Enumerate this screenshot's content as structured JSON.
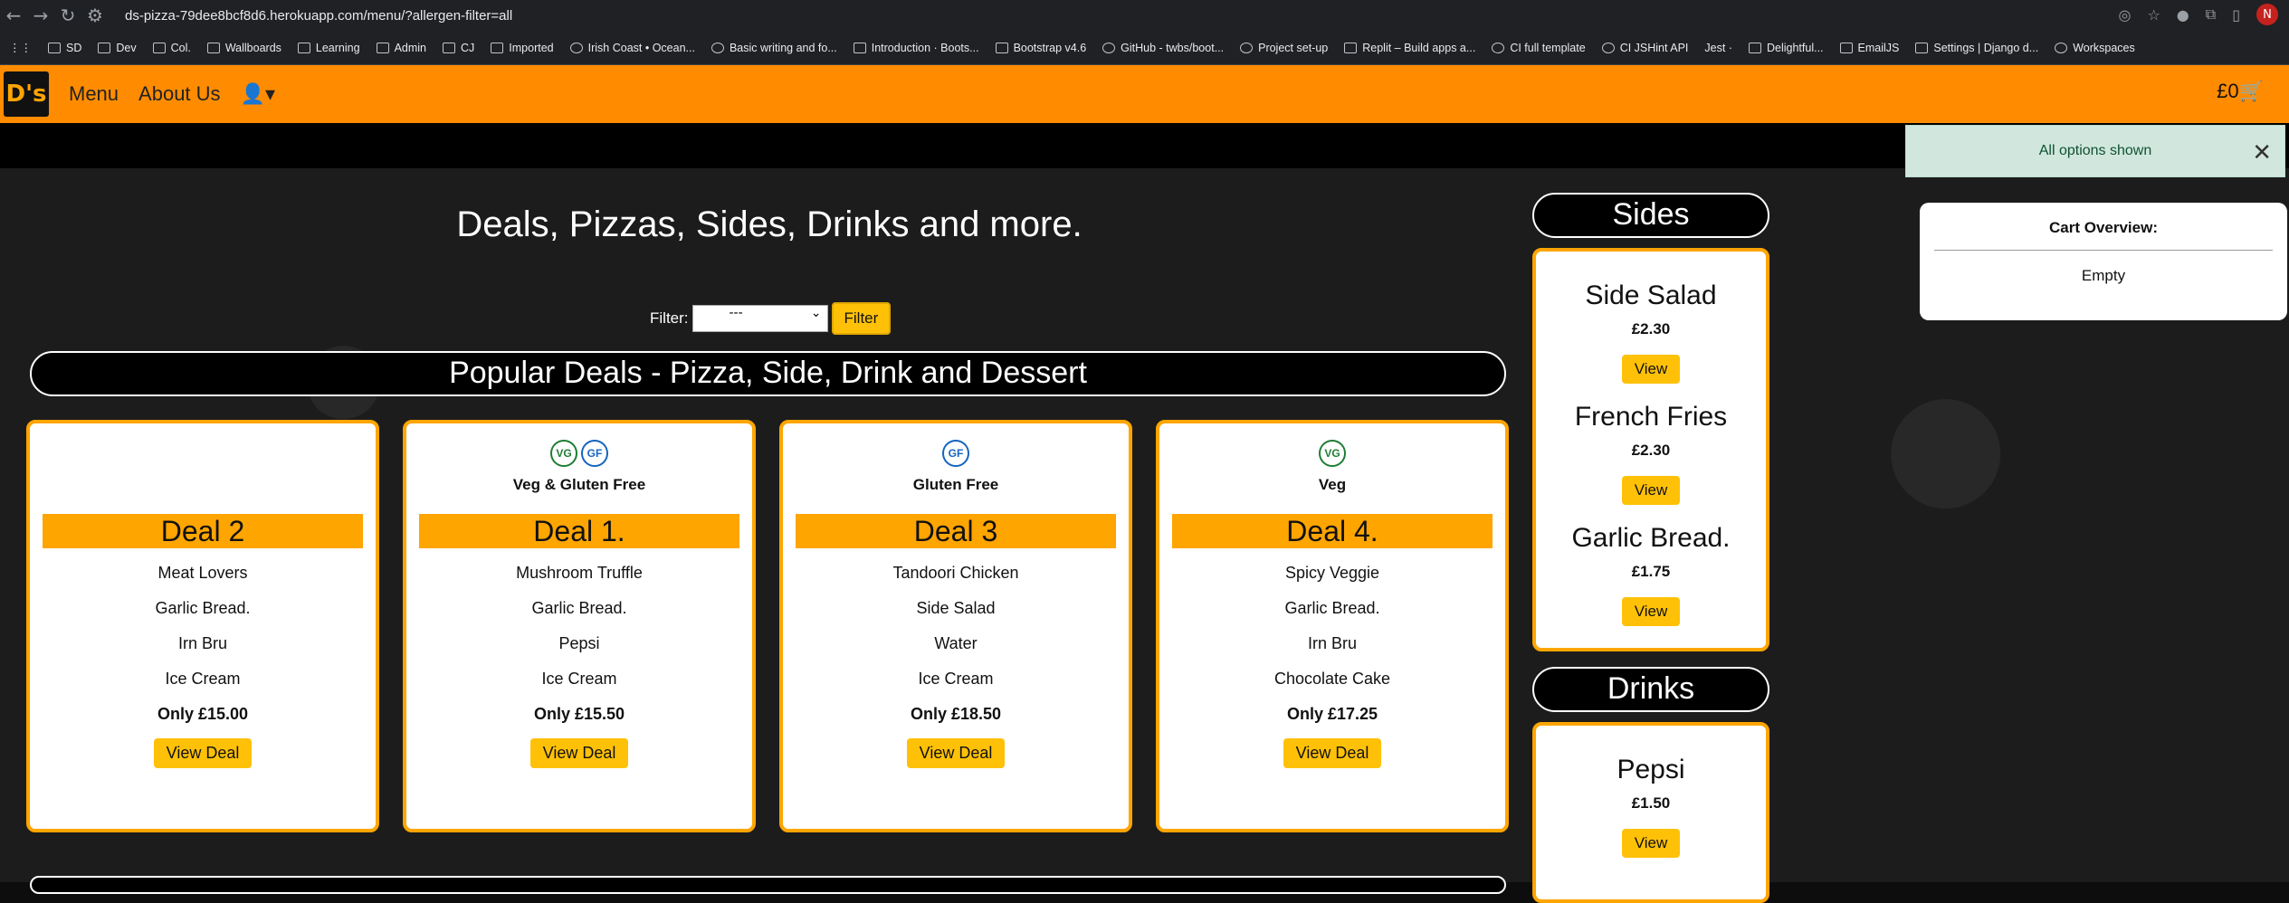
{
  "browser": {
    "url": "ds-pizza-79dee8bcf8d6.herokuapp.com/menu/?allergen-filter=all",
    "profile_initial": "N",
    "bookmarks": [
      "SD",
      "Dev",
      "Col.",
      "Wallboards",
      "Learning",
      "Admin",
      "CJ",
      "Imported",
      "Irish Coast • Ocean...",
      "Basic writing and fo...",
      "Introduction · Boots...",
      "Bootstrap v4.6",
      "GitHub - twbs/boot...",
      "Project set-up",
      "Replit – Build apps a...",
      "CI full template",
      "CI JSHint API",
      "Jest ·",
      "Delightful...",
      "EmailJS",
      "Settings | Django d...",
      "Workspaces"
    ]
  },
  "navbar": {
    "logo": "D's",
    "menu": "Menu",
    "about": "About Us",
    "cart": "£0"
  },
  "alert": {
    "message": "All options shown"
  },
  "main": {
    "title": "Deals, Pizzas, Sides, Drinks and more.",
    "filter_label": "Filter:",
    "filter_value": "---",
    "filter_button": "Filter",
    "deals_section": "Popular Deals - Pizza, Side, Drink and Dessert"
  },
  "deals": [
    {
      "badges": [],
      "diet": "",
      "name": "Deal 2",
      "items": [
        "Meat Lovers",
        "Garlic Bread.",
        "Irn Bru",
        "Ice Cream"
      ],
      "price": "Only £15.00",
      "button": "View Deal"
    },
    {
      "badges": [
        "VG",
        "GF"
      ],
      "diet": "Veg & Gluten Free",
      "name": "Deal 1.",
      "items": [
        "Mushroom Truffle",
        "Garlic Bread.",
        "Pepsi",
        "Ice Cream"
      ],
      "price": "Only £15.50",
      "button": "View Deal"
    },
    {
      "badges": [
        "GF"
      ],
      "diet": "Gluten Free",
      "name": "Deal 3",
      "items": [
        "Tandoori Chicken",
        "Side Salad",
        "Water",
        "Ice Cream"
      ],
      "price": "Only £18.50",
      "button": "View Deal"
    },
    {
      "badges": [
        "VG"
      ],
      "diet": "Veg",
      "name": "Deal 4.",
      "items": [
        "Spicy Veggie",
        "Garlic Bread.",
        "Irn Bru",
        "Chocolate Cake"
      ],
      "price": "Only £17.25",
      "button": "View Deal"
    }
  ],
  "sides": {
    "title": "Sides",
    "items": [
      {
        "name": "Side Salad",
        "price": "£2.30",
        "button": "View"
      },
      {
        "name": "French Fries",
        "price": "£2.30",
        "button": "View"
      },
      {
        "name": "Garlic Bread.",
        "price": "£1.75",
        "button": "View"
      }
    ]
  },
  "drinks": {
    "title": "Drinks",
    "items": [
      {
        "name": "Pepsi",
        "price": "£1.50",
        "button": "View"
      }
    ]
  },
  "cart_overview": {
    "title": "Cart Overview:",
    "status": "Empty"
  },
  "colors": {
    "navbar": "#ff8c00",
    "accent": "#ffa500",
    "button": "#ffc107",
    "alert_bg": "#d1e7dd"
  }
}
